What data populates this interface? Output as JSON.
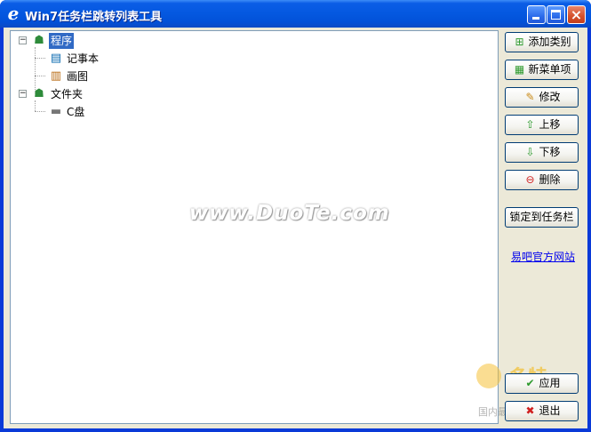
{
  "window": {
    "title": "Win7任务栏跳转列表工具",
    "app_icon_glyph": "e",
    "controls": {
      "minimize": "minimize-icon",
      "maximize": "maximize-icon",
      "close": "×"
    }
  },
  "tree": {
    "nodes": [
      {
        "label": "程序",
        "icon": "org-chart-icon",
        "expander": "−",
        "selected": true
      },
      {
        "label": "记事本",
        "icon": "notepad-icon"
      },
      {
        "label": "画图",
        "icon": "paint-icon"
      },
      {
        "label": "文件夹",
        "icon": "org-chart-icon",
        "expander": "−"
      },
      {
        "label": "C盘",
        "icon": "drive-icon"
      }
    ]
  },
  "watermark": "www.DuoTe.com",
  "buttons": {
    "add_category": "添加类别",
    "new_item": "新菜单项",
    "edit": "修改",
    "move_up": "上移",
    "move_down": "下移",
    "delete": "删除",
    "pin_taskbar": "锁定到任务栏",
    "apply": "应用",
    "exit": "退出"
  },
  "link": {
    "official_site": "易吧官方网站"
  },
  "corner_watermark": {
    "brand": "多特",
    "caption": "国内最安全的软件站"
  },
  "colors": {
    "title_bar": "#0458E0",
    "selection": "#316AC5",
    "dialog_bg": "#ECE9D8",
    "link": "#0000EE"
  }
}
